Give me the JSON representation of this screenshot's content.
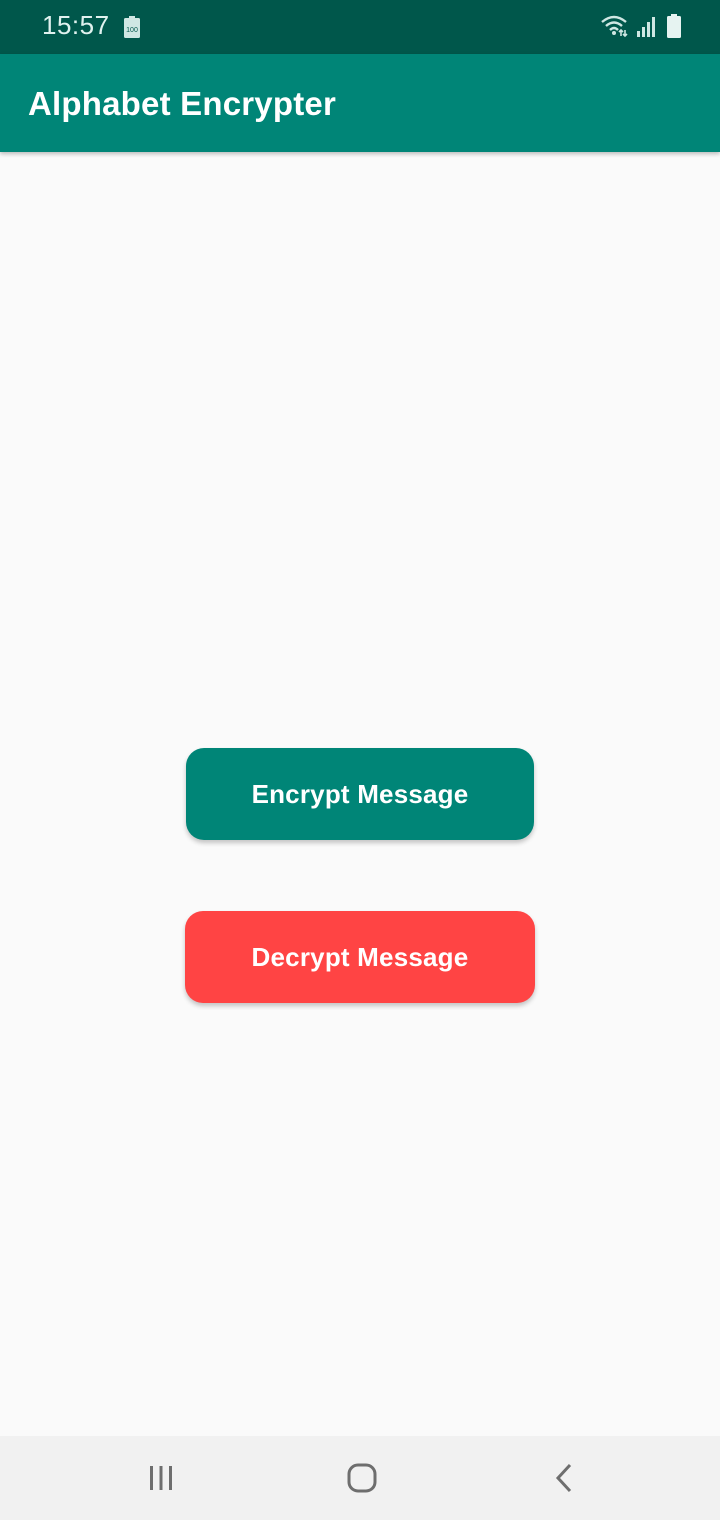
{
  "status_bar": {
    "time": "15:57",
    "battery_small_label": "100",
    "icons": [
      "battery-icon",
      "wifi-icon",
      "signal-icon",
      "battery-full-icon"
    ]
  },
  "app_bar": {
    "title": "Alphabet Encrypter"
  },
  "main": {
    "encrypt_label": "Encrypt Message",
    "decrypt_label": "Decrypt Message"
  },
  "colors": {
    "status_bar": "#00574b",
    "primary": "#008577",
    "decrypt": "#ff4444",
    "background": "#fafafa"
  },
  "nav_bar": {
    "icons": [
      "recent-apps-icon",
      "home-icon",
      "back-icon"
    ]
  }
}
